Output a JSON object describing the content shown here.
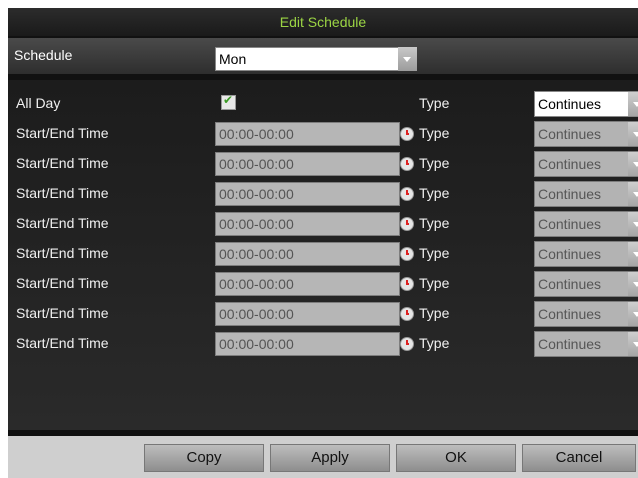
{
  "dialog": {
    "title": "Edit Schedule"
  },
  "schedule": {
    "label": "Schedule",
    "day": "Mon"
  },
  "all_day": {
    "label": "All Day",
    "checked": true,
    "type_label": "Type",
    "type_value": "Continues"
  },
  "rows": [
    {
      "label": "Start/End Time",
      "time": "00:00-00:00",
      "type_label": "Type",
      "type_value": "Continues"
    },
    {
      "label": "Start/End Time",
      "time": "00:00-00:00",
      "type_label": "Type",
      "type_value": "Continues"
    },
    {
      "label": "Start/End Time",
      "time": "00:00-00:00",
      "type_label": "Type",
      "type_value": "Continues"
    },
    {
      "label": "Start/End Time",
      "time": "00:00-00:00",
      "type_label": "Type",
      "type_value": "Continues"
    },
    {
      "label": "Start/End Time",
      "time": "00:00-00:00",
      "type_label": "Type",
      "type_value": "Continues"
    },
    {
      "label": "Start/End Time",
      "time": "00:00-00:00",
      "type_label": "Type",
      "type_value": "Continues"
    },
    {
      "label": "Start/End Time",
      "time": "00:00-00:00",
      "type_label": "Type",
      "type_value": "Continues"
    },
    {
      "label": "Start/End Time",
      "time": "00:00-00:00",
      "type_label": "Type",
      "type_value": "Continues"
    }
  ],
  "buttons": {
    "copy": "Copy",
    "apply": "Apply",
    "ok": "OK",
    "cancel": "Cancel"
  },
  "colors": {
    "title_text": "#9bd444",
    "background": "#111111",
    "footer": "#cfcfcf"
  }
}
